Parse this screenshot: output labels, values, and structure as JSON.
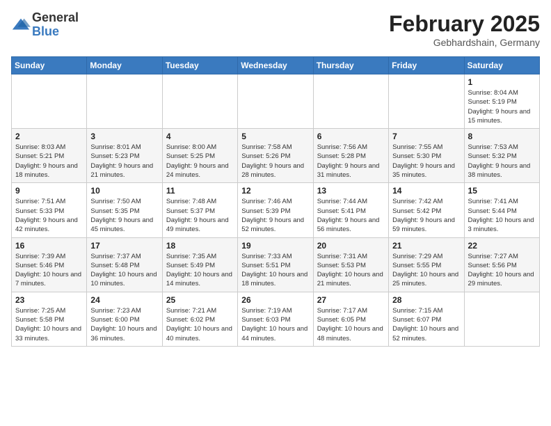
{
  "logo": {
    "general": "General",
    "blue": "Blue"
  },
  "title": "February 2025",
  "location": "Gebhardshain, Germany",
  "days_of_week": [
    "Sunday",
    "Monday",
    "Tuesday",
    "Wednesday",
    "Thursday",
    "Friday",
    "Saturday"
  ],
  "weeks": [
    [
      {
        "day": "",
        "info": ""
      },
      {
        "day": "",
        "info": ""
      },
      {
        "day": "",
        "info": ""
      },
      {
        "day": "",
        "info": ""
      },
      {
        "day": "",
        "info": ""
      },
      {
        "day": "",
        "info": ""
      },
      {
        "day": "1",
        "info": "Sunrise: 8:04 AM\nSunset: 5:19 PM\nDaylight: 9 hours and 15 minutes."
      }
    ],
    [
      {
        "day": "2",
        "info": "Sunrise: 8:03 AM\nSunset: 5:21 PM\nDaylight: 9 hours and 18 minutes."
      },
      {
        "day": "3",
        "info": "Sunrise: 8:01 AM\nSunset: 5:23 PM\nDaylight: 9 hours and 21 minutes."
      },
      {
        "day": "4",
        "info": "Sunrise: 8:00 AM\nSunset: 5:25 PM\nDaylight: 9 hours and 24 minutes."
      },
      {
        "day": "5",
        "info": "Sunrise: 7:58 AM\nSunset: 5:26 PM\nDaylight: 9 hours and 28 minutes."
      },
      {
        "day": "6",
        "info": "Sunrise: 7:56 AM\nSunset: 5:28 PM\nDaylight: 9 hours and 31 minutes."
      },
      {
        "day": "7",
        "info": "Sunrise: 7:55 AM\nSunset: 5:30 PM\nDaylight: 9 hours and 35 minutes."
      },
      {
        "day": "8",
        "info": "Sunrise: 7:53 AM\nSunset: 5:32 PM\nDaylight: 9 hours and 38 minutes."
      }
    ],
    [
      {
        "day": "9",
        "info": "Sunrise: 7:51 AM\nSunset: 5:33 PM\nDaylight: 9 hours and 42 minutes."
      },
      {
        "day": "10",
        "info": "Sunrise: 7:50 AM\nSunset: 5:35 PM\nDaylight: 9 hours and 45 minutes."
      },
      {
        "day": "11",
        "info": "Sunrise: 7:48 AM\nSunset: 5:37 PM\nDaylight: 9 hours and 49 minutes."
      },
      {
        "day": "12",
        "info": "Sunrise: 7:46 AM\nSunset: 5:39 PM\nDaylight: 9 hours and 52 minutes."
      },
      {
        "day": "13",
        "info": "Sunrise: 7:44 AM\nSunset: 5:41 PM\nDaylight: 9 hours and 56 minutes."
      },
      {
        "day": "14",
        "info": "Sunrise: 7:42 AM\nSunset: 5:42 PM\nDaylight: 9 hours and 59 minutes."
      },
      {
        "day": "15",
        "info": "Sunrise: 7:41 AM\nSunset: 5:44 PM\nDaylight: 10 hours and 3 minutes."
      }
    ],
    [
      {
        "day": "16",
        "info": "Sunrise: 7:39 AM\nSunset: 5:46 PM\nDaylight: 10 hours and 7 minutes."
      },
      {
        "day": "17",
        "info": "Sunrise: 7:37 AM\nSunset: 5:48 PM\nDaylight: 10 hours and 10 minutes."
      },
      {
        "day": "18",
        "info": "Sunrise: 7:35 AM\nSunset: 5:49 PM\nDaylight: 10 hours and 14 minutes."
      },
      {
        "day": "19",
        "info": "Sunrise: 7:33 AM\nSunset: 5:51 PM\nDaylight: 10 hours and 18 minutes."
      },
      {
        "day": "20",
        "info": "Sunrise: 7:31 AM\nSunset: 5:53 PM\nDaylight: 10 hours and 21 minutes."
      },
      {
        "day": "21",
        "info": "Sunrise: 7:29 AM\nSunset: 5:55 PM\nDaylight: 10 hours and 25 minutes."
      },
      {
        "day": "22",
        "info": "Sunrise: 7:27 AM\nSunset: 5:56 PM\nDaylight: 10 hours and 29 minutes."
      }
    ],
    [
      {
        "day": "23",
        "info": "Sunrise: 7:25 AM\nSunset: 5:58 PM\nDaylight: 10 hours and 33 minutes."
      },
      {
        "day": "24",
        "info": "Sunrise: 7:23 AM\nSunset: 6:00 PM\nDaylight: 10 hours and 36 minutes."
      },
      {
        "day": "25",
        "info": "Sunrise: 7:21 AM\nSunset: 6:02 PM\nDaylight: 10 hours and 40 minutes."
      },
      {
        "day": "26",
        "info": "Sunrise: 7:19 AM\nSunset: 6:03 PM\nDaylight: 10 hours and 44 minutes."
      },
      {
        "day": "27",
        "info": "Sunrise: 7:17 AM\nSunset: 6:05 PM\nDaylight: 10 hours and 48 minutes."
      },
      {
        "day": "28",
        "info": "Sunrise: 7:15 AM\nSunset: 6:07 PM\nDaylight: 10 hours and 52 minutes."
      },
      {
        "day": "",
        "info": ""
      }
    ]
  ]
}
